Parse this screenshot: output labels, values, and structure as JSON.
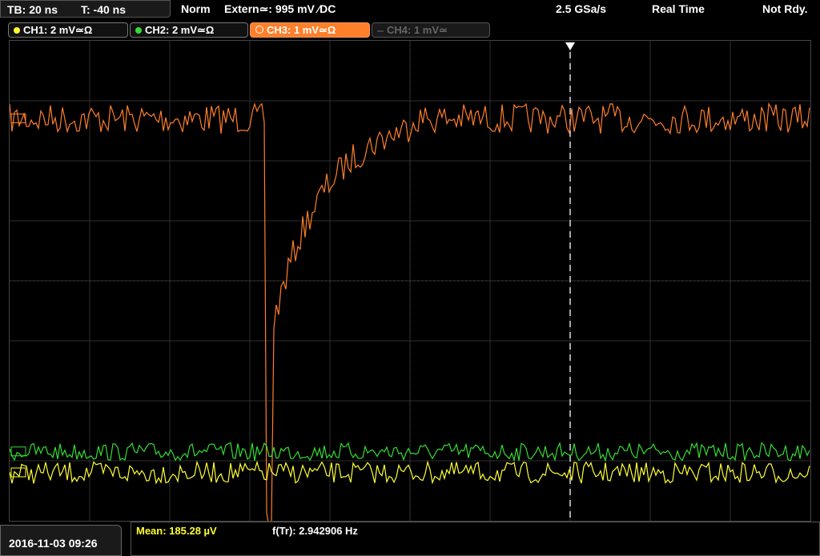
{
  "header": {
    "timebase": "TB: 20 ns",
    "trigger_pos": "T: -40 ns",
    "mode": "Norm",
    "trigger": "Extern≃: 995 mV ∕DC",
    "sample_rate": "2.5 GSa/s",
    "acq": "Real Time",
    "status": "Not Rdy."
  },
  "channels": [
    {
      "label": "CH1: 2 mV≃Ω",
      "color": "#ffff33",
      "active": true
    },
    {
      "label": "CH2: 2 mV≃Ω",
      "color": "#33dd33",
      "active": true
    },
    {
      "label": "CH3: 1 mV≃Ω",
      "color": "#ff7f2a",
      "active": true,
      "selected": true
    },
    {
      "label": "CH4: 1 mV≃",
      "color": "#555555",
      "active": false
    }
  ],
  "footer": {
    "date": "2016-11-03 09:26",
    "mean": "Mean: 185.28 µV",
    "freq": "f(Tr): 2.942906 Hz"
  },
  "colors": {
    "ch1": "#ffff33",
    "ch2": "#33dd33",
    "ch3": "#ff7f2a",
    "grid": "#333333"
  },
  "chart_data": {
    "type": "line",
    "grid": true,
    "xdivs": 10,
    "ydivs": 8,
    "trigger_x_div": 7.0,
    "series": [
      {
        "name": "CH3",
        "color": "#ff7f2a",
        "shape": "step-recovery",
        "baseline_div": 1.3,
        "dip_x_div": 3.25,
        "dip_y_div": 8.0,
        "recovery_end_div": 5.0,
        "noise_div": 0.25
      },
      {
        "name": "CH2",
        "color": "#33dd33",
        "shape": "noise",
        "baseline_div": 6.85,
        "noise_div": 0.15
      },
      {
        "name": "CH1",
        "color": "#ffff33",
        "shape": "noise",
        "baseline_div": 7.2,
        "noise_div": 0.18
      }
    ]
  }
}
